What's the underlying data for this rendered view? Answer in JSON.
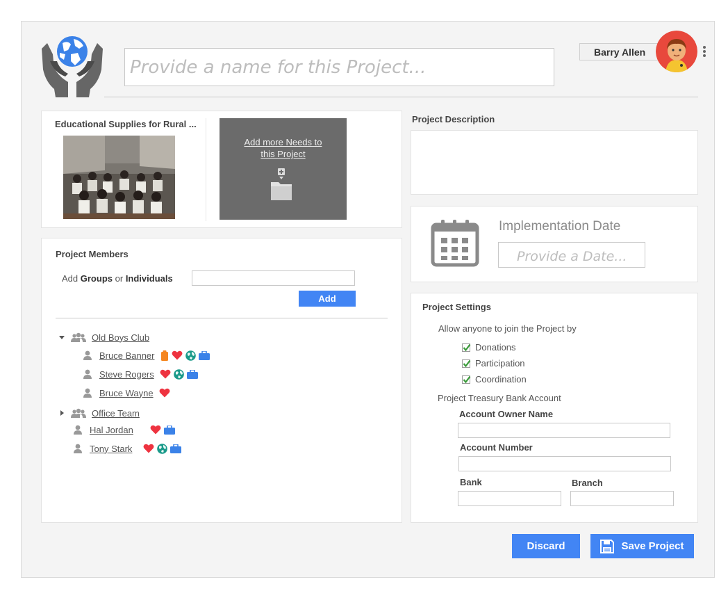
{
  "header": {
    "name_placeholder": "Provide a name for this Project..."
  },
  "user": {
    "name": "Barry Allen"
  },
  "needs": {
    "first_need_title": "Educational Supplies for Rural ...",
    "add_more_label": "Add more Needs to this Project"
  },
  "members": {
    "title": "Project Members",
    "add_label_prefix": "Add",
    "add_label_groups": "Groups",
    "add_label_or": "or",
    "add_label_individuals": "Individuals",
    "add_button": "Add",
    "groups": [
      {
        "name": "Old Boys Club",
        "expanded": true,
        "members": [
          {
            "name": "Bruce Banner",
            "badges": [
              "clipboard-icon",
              "heart-icon",
              "globe-icon",
              "briefcase-icon"
            ]
          },
          {
            "name": "Steve Rogers",
            "badges": [
              "heart-icon",
              "globe-icon",
              "briefcase-icon"
            ]
          },
          {
            "name": "Bruce Wayne",
            "badges": [
              "heart-icon"
            ]
          }
        ]
      },
      {
        "name": "Office Team",
        "expanded": false,
        "members": []
      }
    ],
    "individuals": [
      {
        "name": "Hal Jordan",
        "badges": [
          "heart-icon",
          "briefcase-icon"
        ]
      },
      {
        "name": "Tony Stark",
        "badges": [
          "heart-icon",
          "globe-icon",
          "briefcase-icon"
        ]
      }
    ]
  },
  "description": {
    "title": "Project Description"
  },
  "implementation": {
    "label": "Implementation Date",
    "placeholder": "Provide a Date..."
  },
  "settings": {
    "title": "Project Settings",
    "allow_label": "Allow anyone to join the Project by",
    "options": [
      {
        "label": "Donations",
        "checked": true
      },
      {
        "label": "Participation",
        "checked": true
      },
      {
        "label": "Coordination",
        "checked": true
      }
    ],
    "bank_title": "Project Treasury Bank Account",
    "account_owner_label": "Account Owner Name",
    "account_number_label": "Account Number",
    "bank_label": "Bank",
    "branch_label": "Branch"
  },
  "actions": {
    "discard": "Discard",
    "save": "Save Project"
  },
  "colors": {
    "accent": "#4285f4",
    "heart": "#ee3340",
    "globe": "#1a9a8a",
    "clipboard": "#f5861f",
    "check": "#3a9b3a"
  }
}
